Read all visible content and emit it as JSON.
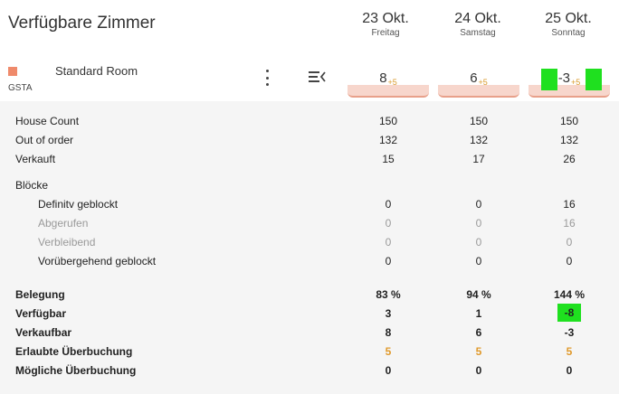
{
  "title": "Verfügbare Zimmer",
  "dates": [
    {
      "date": "23 Okt.",
      "weekday": "Freitag"
    },
    {
      "date": "24 Okt.",
      "weekday": "Samstag"
    },
    {
      "date": "25 Okt.",
      "weekday": "Sonntag"
    }
  ],
  "room": {
    "name": "Standard Room",
    "code": "GSTA",
    "color": "#ef8a6b",
    "available": [
      {
        "value": "8",
        "extra": "+5"
      },
      {
        "value": "6",
        "extra": "+5"
      },
      {
        "value": "-3",
        "extra": "+5"
      }
    ]
  },
  "rows": {
    "house_count": {
      "label": "House Count",
      "values": [
        "150",
        "150",
        "150"
      ]
    },
    "out_of_order": {
      "label": "Out of order",
      "values": [
        "132",
        "132",
        "132"
      ]
    },
    "verkauft": {
      "label": "Verkauft",
      "values": [
        "15",
        "17",
        "26"
      ]
    },
    "bloecke": {
      "label": "Blöcke"
    },
    "definitiv": {
      "label": "Definitv geblockt",
      "values": [
        "0",
        "0",
        "16"
      ]
    },
    "abgerufen": {
      "label": "Abgerufen",
      "values": [
        "0",
        "0",
        "16"
      ]
    },
    "verbleibend": {
      "label": "Verbleibend",
      "values": [
        "0",
        "0",
        "0"
      ]
    },
    "voruebergehend": {
      "label": "Vorübergehend geblockt",
      "values": [
        "0",
        "0",
        "0"
      ]
    },
    "belegung": {
      "label": "Belegung",
      "values": [
        "83 %",
        "94 %",
        "144 %"
      ]
    },
    "verfuegbar": {
      "label": "Verfügbar",
      "values": [
        "3",
        "1",
        "-8"
      ]
    },
    "verkaufbar": {
      "label": "Verkaufbar",
      "values": [
        "8",
        "6",
        "-3"
      ]
    },
    "erlaubte": {
      "label": "Erlaubte Überbuchung",
      "values": [
        "5",
        "5",
        "5"
      ]
    },
    "moegliche": {
      "label": "Mögliche Überbuchung",
      "values": [
        "0",
        "0",
        "0"
      ]
    }
  },
  "colors": {
    "accent_orange": "#e09a2c",
    "highlight_green": "#1fe01f",
    "pill_fill": "#f7d6cc"
  },
  "icons": [
    "more-vert-icon",
    "collapse-menu-icon"
  ]
}
